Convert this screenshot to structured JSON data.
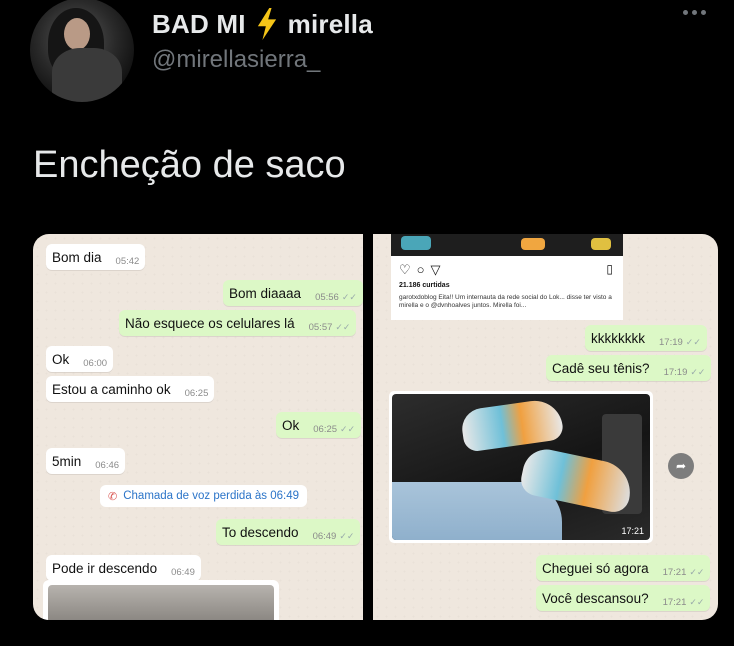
{
  "tweet": {
    "display_name": "BAD MI",
    "display_name_suffix": "mirella",
    "handle": "@mirellasierra_",
    "text": "Encheção de saco",
    "bolt_color": "#f5c518"
  },
  "left_chat": [
    {
      "dir": "in",
      "text": "Bom dia",
      "time": "05:42"
    },
    {
      "dir": "out",
      "text": "Bom diaaaa",
      "time": "05:56"
    },
    {
      "dir": "out",
      "text": "Não esquece os celulares lá",
      "time": "05:57"
    },
    {
      "dir": "in",
      "text": "Ok",
      "time": "06:00"
    },
    {
      "dir": "in",
      "text": "Estou a caminho ok",
      "time": "06:25"
    },
    {
      "dir": "out",
      "text": "Ok",
      "time": "06:25"
    },
    {
      "dir": "in",
      "text": "5min",
      "time": "06:46"
    },
    {
      "dir": "out",
      "text": "To descendo",
      "time": "06:49"
    },
    {
      "dir": "in",
      "text": "Pode ir descendo",
      "time": "06:49"
    }
  ],
  "missed_call": "Chamada de voz perdida às 06:49",
  "instagram": {
    "likes": "21.186 curtidas",
    "caption": "garotxdoblog Eita!! Um internauta da rede social do Lok... disse ter visto a mirella e o @dvnhoalves juntos. Mirella foi..."
  },
  "right_chat": [
    {
      "dir": "out",
      "text": "kkkkkkkk",
      "time": "17:19"
    },
    {
      "dir": "out",
      "text": "Cadê seu tênis?",
      "time": "17:19"
    },
    {
      "dir": "out",
      "text": "Cheguei só agora",
      "time": "17:21"
    },
    {
      "dir": "out",
      "text": "Você descansou?",
      "time": "17:21"
    }
  ],
  "photo_time": "17:21",
  "ticks": "✓✓"
}
